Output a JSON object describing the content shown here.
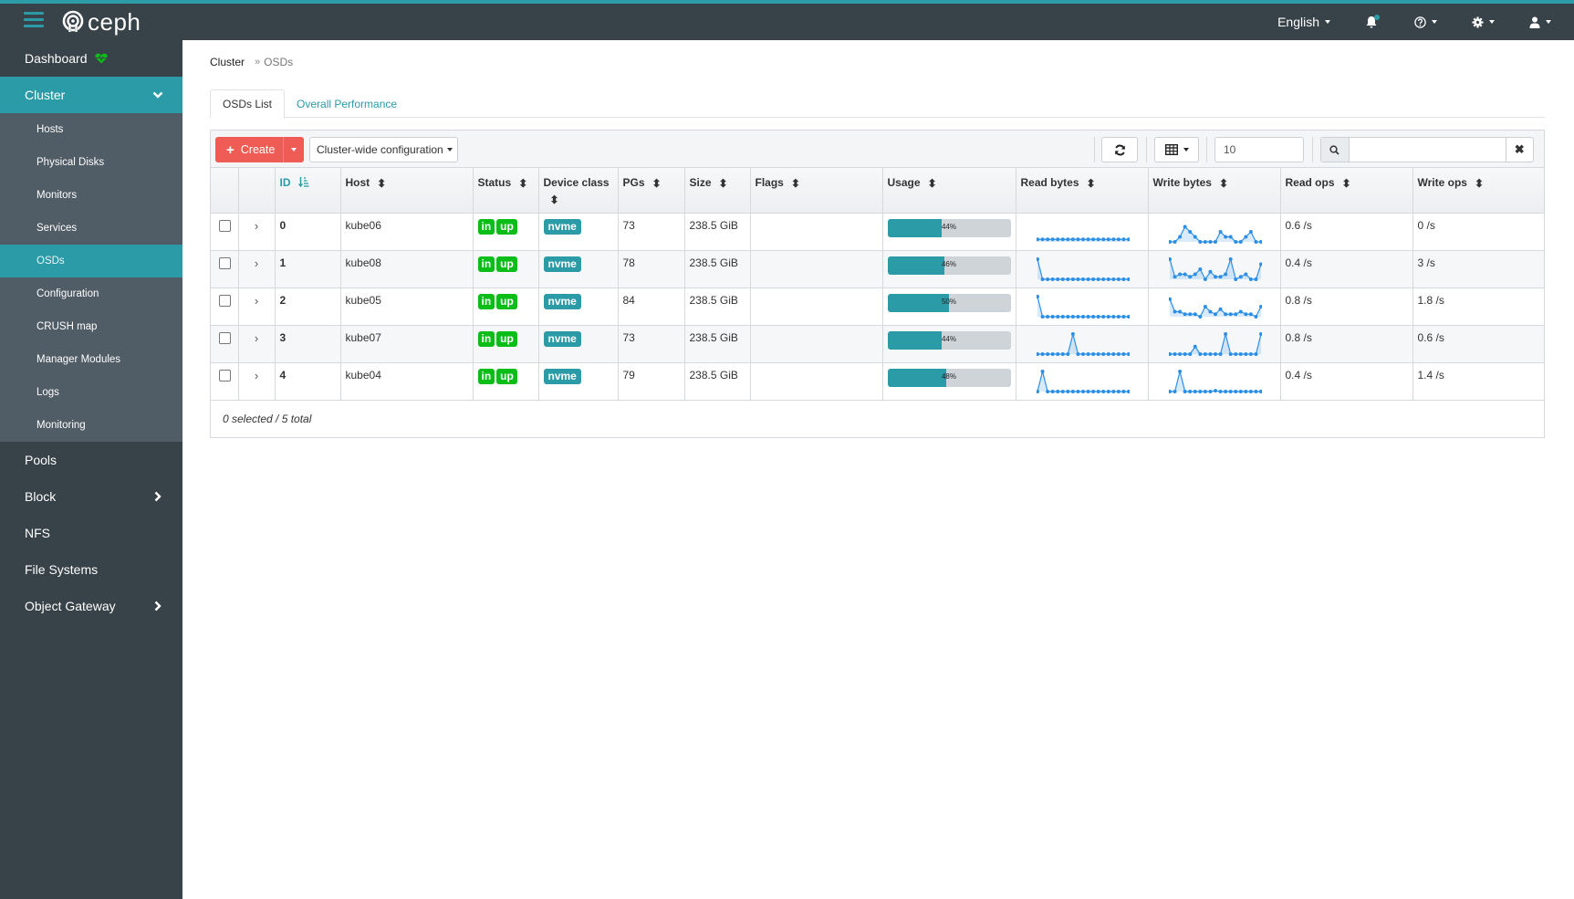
{
  "app": {
    "brand": "ceph",
    "nav": {
      "language": "English",
      "icons": [
        "bell-icon",
        "help-icon",
        "gear-icon",
        "user-icon"
      ]
    }
  },
  "sidebar": {
    "dashboard": {
      "label": "Dashboard",
      "status_icon": "heartbeat-icon",
      "status_color": "#0bbd17"
    },
    "cluster": {
      "label": "Cluster",
      "expanded": true,
      "items": [
        {
          "label": "Hosts"
        },
        {
          "label": "Physical Disks"
        },
        {
          "label": "Monitors"
        },
        {
          "label": "Services"
        },
        {
          "label": "OSDs",
          "active": true
        },
        {
          "label": "Configuration"
        },
        {
          "label": "CRUSH map"
        },
        {
          "label": "Manager Modules"
        },
        {
          "label": "Logs"
        },
        {
          "label": "Monitoring"
        }
      ]
    },
    "items": [
      {
        "label": "Pools",
        "has_children": false
      },
      {
        "label": "Block",
        "has_children": true
      },
      {
        "label": "NFS",
        "has_children": false
      },
      {
        "label": "File Systems",
        "has_children": false
      },
      {
        "label": "Object Gateway",
        "has_children": true
      }
    ]
  },
  "breadcrumb": {
    "root": "Cluster",
    "separator": "»",
    "current": "OSDs"
  },
  "tabs": [
    {
      "label": "OSDs List",
      "active": true
    },
    {
      "label": "Overall Performance",
      "active": false
    }
  ],
  "toolbar": {
    "create_label": "Create",
    "cluster_config_label": "Cluster-wide configuration",
    "page_size": "10",
    "search_value": "",
    "search_placeholder": ""
  },
  "table": {
    "columns": [
      {
        "label": "ID",
        "sorted": true
      },
      {
        "label": "Host"
      },
      {
        "label": "Status"
      },
      {
        "label": "Device class"
      },
      {
        "label": "PGs"
      },
      {
        "label": "Size"
      },
      {
        "label": "Flags"
      },
      {
        "label": "Usage"
      },
      {
        "label": "Read bytes"
      },
      {
        "label": "Write bytes"
      },
      {
        "label": "Read ops"
      },
      {
        "label": "Write ops"
      }
    ],
    "rows": [
      {
        "id": "0",
        "host": "kube06",
        "status": [
          "in",
          "up"
        ],
        "device_class": "nvme",
        "pgs": "73",
        "size": "238.5 GiB",
        "flags": "",
        "usage": 44,
        "usage_label": "44%",
        "read_bytes": [
          1,
          1,
          1,
          1,
          1,
          1,
          1,
          1,
          1,
          1,
          1,
          1,
          1,
          1,
          1,
          1,
          1,
          1,
          1
        ],
        "write_bytes": [
          0,
          0,
          2,
          6,
          4,
          2,
          0,
          0,
          0,
          0,
          4,
          2,
          2,
          0,
          0,
          2,
          4,
          0,
          0
        ],
        "read_ops": "0.6 /s",
        "write_ops": "0 /s"
      },
      {
        "id": "1",
        "host": "kube08",
        "status": [
          "in",
          "up"
        ],
        "device_class": "nvme",
        "pgs": "78",
        "size": "238.5 GiB",
        "flags": "",
        "usage": 46,
        "usage_label": "46%",
        "read_bytes": [
          8,
          0,
          0,
          0,
          0,
          0,
          0,
          0,
          0,
          0,
          0,
          0,
          0,
          0,
          0,
          0,
          0,
          0,
          0
        ],
        "write_bytes": [
          8,
          1,
          2,
          2,
          1,
          2,
          4,
          0,
          3,
          1,
          1,
          2,
          8,
          0,
          1,
          2,
          0,
          0,
          6
        ],
        "read_ops": "0.4 /s",
        "write_ops": "3 /s"
      },
      {
        "id": "2",
        "host": "kube05",
        "status": [
          "in",
          "up"
        ],
        "device_class": "nvme",
        "pgs": "84",
        "size": "238.5 GiB",
        "flags": "",
        "usage": 50,
        "usage_label": "50%",
        "read_bytes": [
          8,
          0,
          0,
          0,
          0,
          0,
          0,
          0,
          0,
          0,
          0,
          0,
          0,
          0,
          0,
          0,
          0,
          0,
          0
        ],
        "write_bytes": [
          7,
          2,
          2,
          1,
          1,
          1,
          0,
          4,
          2,
          1,
          3,
          1,
          1,
          1,
          2,
          1,
          1,
          0,
          4
        ],
        "read_ops": "0.8 /s",
        "write_ops": "1.8 /s"
      },
      {
        "id": "3",
        "host": "kube07",
        "status": [
          "in",
          "up"
        ],
        "device_class": "nvme",
        "pgs": "73",
        "size": "238.5 GiB",
        "flags": "",
        "usage": 44,
        "usage_label": "44%",
        "read_bytes": [
          0,
          0,
          0,
          0,
          0,
          0,
          0,
          8,
          0,
          0,
          0,
          0,
          0,
          0,
          0,
          0,
          0,
          0,
          0
        ],
        "write_bytes": [
          0,
          0,
          0,
          0,
          0,
          3,
          0,
          0,
          0,
          0,
          0,
          8,
          0,
          0,
          0,
          0,
          0,
          0,
          8
        ],
        "read_ops": "0.8 /s",
        "write_ops": "0.6 /s"
      },
      {
        "id": "4",
        "host": "kube04",
        "status": [
          "in",
          "up"
        ],
        "device_class": "nvme",
        "pgs": "79",
        "size": "238.5 GiB",
        "flags": "",
        "usage": 48,
        "usage_label": "48%",
        "read_bytes": [
          0,
          8,
          0,
          0,
          0,
          0,
          0,
          0,
          0,
          0,
          0,
          0,
          0,
          0,
          0,
          0,
          0,
          0,
          0
        ],
        "write_bytes": [
          0,
          0,
          8,
          0,
          0,
          0,
          0,
          0,
          0,
          0.3,
          0,
          0,
          0,
          0,
          0,
          0,
          0,
          0,
          0
        ],
        "read_ops": "0.4 /s",
        "write_ops": "1.4 /s"
      }
    ],
    "footer": "0 selected / 5 total"
  },
  "colors": {
    "accent": "#2a9ba7",
    "topbar": "#374249",
    "sidebar_sub": "#505c66",
    "create_button": "#ef5c55",
    "status_green": "#0bbd17",
    "sparkline": "#2c8fe6"
  }
}
